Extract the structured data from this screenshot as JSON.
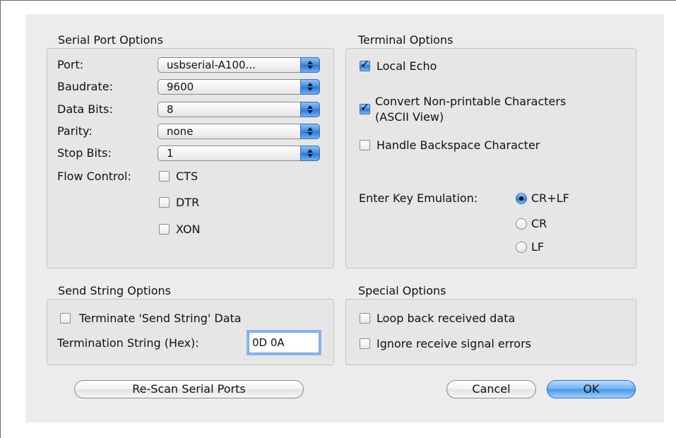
{
  "serial_port_options": {
    "title": "Serial Port Options",
    "port": {
      "label": "Port:",
      "value": "usbserial-A100..."
    },
    "baudrate": {
      "label": "Baudrate:",
      "value": "9600"
    },
    "data_bits": {
      "label": "Data Bits:",
      "value": "8"
    },
    "parity": {
      "label": "Parity:",
      "value": "none"
    },
    "stop_bits": {
      "label": "Stop Bits:",
      "value": "1"
    },
    "flow_control": {
      "label": "Flow Control:",
      "options": [
        {
          "label": "CTS",
          "checked": false
        },
        {
          "label": "DTR",
          "checked": false
        },
        {
          "label": "XON",
          "checked": false
        }
      ]
    }
  },
  "terminal_options": {
    "title": "Terminal Options",
    "local_echo": {
      "label": "Local Echo",
      "checked": true
    },
    "convert_nonprintable": {
      "line1": "Convert Non-printable Characters",
      "line2": "(ASCII View)",
      "checked": true
    },
    "handle_backspace": {
      "label": "Handle Backspace Character",
      "checked": false
    },
    "enter_key": {
      "label": "Enter Key Emulation:",
      "options": [
        {
          "label": "CR+LF",
          "selected": true
        },
        {
          "label": "CR",
          "selected": false
        },
        {
          "label": "LF",
          "selected": false
        }
      ]
    }
  },
  "send_string_options": {
    "title": "Send String Options",
    "terminate": {
      "label": "Terminate 'Send String' Data",
      "checked": false
    },
    "termination_string": {
      "label": "Termination String (Hex):",
      "value": "0D 0A"
    }
  },
  "special_options": {
    "title": "Special Options",
    "loop_back": {
      "label": "Loop back received data",
      "checked": false
    },
    "ignore_errors": {
      "label": "Ignore receive signal errors",
      "checked": false
    }
  },
  "buttons": {
    "rescan": "Re-Scan Serial Ports",
    "cancel": "Cancel",
    "ok": "OK"
  },
  "colors": {
    "panel_background": "#ececec",
    "accent_blue": "#3d8ae3"
  }
}
